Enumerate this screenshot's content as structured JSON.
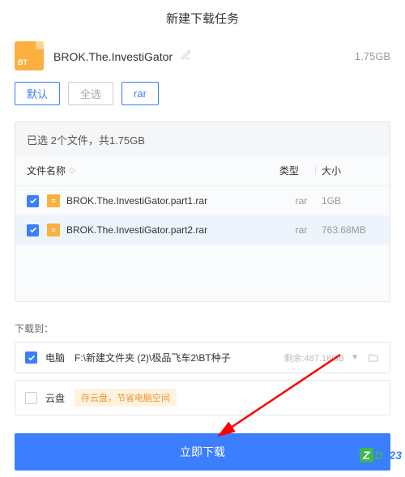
{
  "header": {
    "title": "新建下载任务"
  },
  "task": {
    "name": "BROK.The.InvestiGator",
    "size": "1.75GB"
  },
  "filters": {
    "default": "默认",
    "select_all": "全选",
    "rar": "rar"
  },
  "panel": {
    "summary": "已选 2个文件，共1.75GB",
    "col_name": "文件名称",
    "col_type": "类型",
    "col_size": "大小"
  },
  "files": [
    {
      "name": "BROK.The.InvestiGator.part1.rar",
      "type": "rar",
      "size": "1GB"
    },
    {
      "name": "BROK.The.InvestiGator.part2.rar",
      "type": "rar",
      "size": "763.68MB"
    }
  ],
  "download": {
    "section_label": "下载到：",
    "pc_label": "电脑",
    "pc_path": "F:\\新建文件夹 (2)\\极品飞车2\\BT种子",
    "pc_remain": "剩余:487.18GB",
    "cloud_label": "云盘",
    "cloud_tip": "存云盘，节省电脑空间"
  },
  "actions": {
    "primary": "立即下载"
  },
  "watermark": {
    "z": "Z",
    "d": "D",
    "rest": "423"
  }
}
